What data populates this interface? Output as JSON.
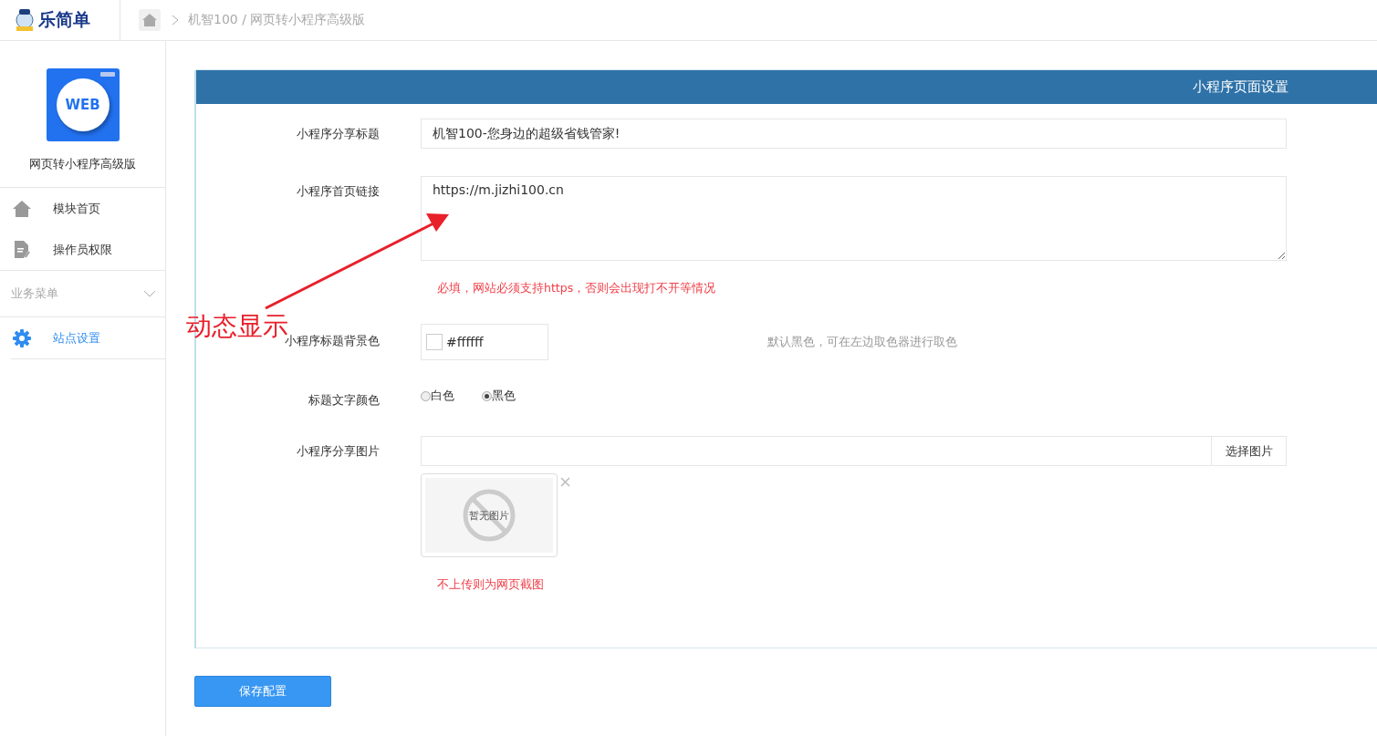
{
  "header": {
    "logo_text": "乐简单",
    "breadcrumb": "机智100 / 网页转小程序高级版"
  },
  "sidebar": {
    "app_name": "网页转小程序高级版",
    "app_icon_text": "WEB",
    "items": [
      {
        "label": "模块首页",
        "selected": false
      },
      {
        "label": "操作员权限",
        "selected": false
      }
    ],
    "section": {
      "label": "业务菜单",
      "expanded": true,
      "items": [
        {
          "label": "站点设置",
          "selected": true
        }
      ]
    }
  },
  "panel": {
    "title": "小程序页面设置",
    "fields": [
      {
        "kind": "text",
        "label": "小程序分享标题",
        "value": "机智100-您身边的超级省钱管家!"
      },
      {
        "kind": "textarea",
        "label": "小程序首页链接",
        "value": "https://m.jizhi100.cn",
        "note": "必填，网站必须支持https，否则会出现打不开等情况"
      },
      {
        "kind": "color",
        "label": "小程序标题背景色",
        "value": "#ffffff",
        "hint": "默认黑色，可在左边取色器进行取色"
      },
      {
        "kind": "radio",
        "label": "标题文字颜色",
        "options": [
          {
            "label": "白色",
            "selected": false
          },
          {
            "label": "黑色",
            "selected": true
          }
        ]
      },
      {
        "kind": "image",
        "label": "小程序分享图片",
        "button": "选择图片",
        "empty_text": "暂无图片",
        "note": "不上传则为网页截图"
      }
    ]
  },
  "save_button": "保存配置",
  "annotation": {
    "text": "动态显示"
  }
}
